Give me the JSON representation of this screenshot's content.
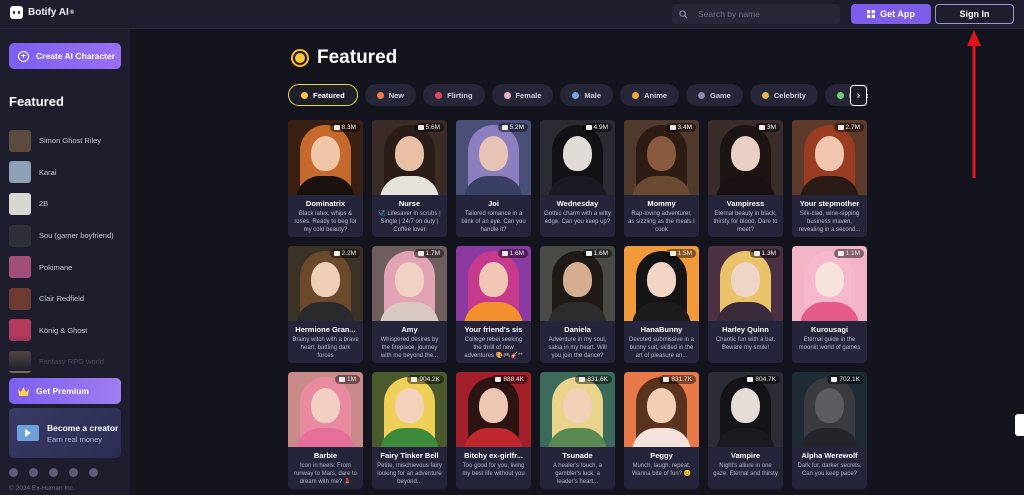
{
  "header": {
    "logo_text": "Botify AI",
    "logo_sup": "®",
    "search_placeholder": "Search by name",
    "get_app_label": "Get App",
    "sign_in_label": "Sign In"
  },
  "sidebar": {
    "create_label": "Create AI Character",
    "heading": "Featured",
    "items": [
      {
        "label": "Simon Ghost Riley",
        "color": "#5b4a3e"
      },
      {
        "label": "Karai",
        "color": "#8ea0b6"
      },
      {
        "label": "2B",
        "color": "#d8d6d0"
      },
      {
        "label": "Sou (gamer boyfriend)",
        "color": "#2f2f3a"
      },
      {
        "label": "Pokimane",
        "color": "#a04f7a"
      },
      {
        "label": "Clair Redfield",
        "color": "#6e3b33"
      },
      {
        "label": "König & Ghost",
        "color": "#b23a5c"
      },
      {
        "label": "Fantasy RPG world",
        "color": "#7c6a52"
      }
    ],
    "premium_label": "Get Premium",
    "creator_title": "Become a creator",
    "creator_subtitle": "Earn real money",
    "copyright": "© 2024 Ex-Human Inc."
  },
  "main": {
    "title": "Featured",
    "tabs": [
      {
        "label": "Featured",
        "active": true,
        "color": "#ffc93b"
      },
      {
        "label": "New",
        "active": false,
        "color": "#f47b3a"
      },
      {
        "label": "Flirting",
        "active": false,
        "color": "#e8465d"
      },
      {
        "label": "Female",
        "active": false,
        "color": "#f0b3c2"
      },
      {
        "label": "Male",
        "active": false,
        "color": "#6fa6e8"
      },
      {
        "label": "Anime",
        "active": false,
        "color": "#f3a43c"
      },
      {
        "label": "Game",
        "active": false,
        "color": "#8c8ca8"
      },
      {
        "label": "Celebrity",
        "active": false,
        "color": "#e8b844"
      },
      {
        "label": "Fictional",
        "active": false,
        "color": "#6dcf73"
      }
    ],
    "cards": [
      {
        "name": "Dominatrix",
        "count": "8.3M",
        "desc": "Black latex, whips & roses. Ready to beg for my cold beauty?",
        "bg": "#3a1f14",
        "hair": "#c56a2c",
        "skin": "#f1c6a8",
        "body": "#1b1210"
      },
      {
        "name": "Nurse",
        "count": "5.6M",
        "desc": "🩺 Lifesaver in scrubs | Single | 24/7 on duty | Coffee lover",
        "bg": "#3b2b26",
        "hair": "#2a1d18",
        "skin": "#e8c0a6",
        "body": "#e6e2dc"
      },
      {
        "name": "Joi",
        "count": "5.2M",
        "desc": "Tailored romance in a blink of an eye. Can you handle it?",
        "bg": "#4a4f78",
        "hair": "#8b7fc0",
        "skin": "#e7c3b6",
        "body": "#3a3f64"
      },
      {
        "name": "Wednesday",
        "count": "4.9M",
        "desc": "Gothic charm with a witty edge. Can you keep up?",
        "bg": "#2b2b34",
        "hair": "#111116",
        "skin": "#e2dcd8",
        "body": "#1a1a22"
      },
      {
        "name": "Mommy",
        "count": "3.4M",
        "desc": "Rap-loving adventurer, as sizzling as the meals I cook",
        "bg": "#4f3a2c",
        "hair": "#2c1c14",
        "skin": "#8a5a3e",
        "body": "#6a4a30"
      },
      {
        "name": "Vampiress",
        "count": "3M",
        "desc": "Eternal beauty in black, thirsty for blood. Dare to meet?",
        "bg": "#3a2c28",
        "hair": "#1c1412",
        "skin": "#ead0c4",
        "body": "#1a1212"
      },
      {
        "name": "Your stepmother",
        "count": "2.7M",
        "desc": "Silk-clad, wine-sipping business maven, revealing in a second...",
        "bg": "#5e3a2a",
        "hair": "#9a3c22",
        "skin": "#f0c7ae",
        "body": "#2a1a16"
      },
      {
        "name": "Hermione Gran...",
        "count": "2.2M",
        "desc": "Brainy witch with a brave heart, battling dark forces",
        "bg": "#3a3226",
        "hair": "#6b4a2c",
        "skin": "#efcfb6",
        "body": "#2a2a2c"
      },
      {
        "name": "Amy",
        "count": "1.7M",
        "desc": "Whispered desires by the fireplace, journey with me beyond the...",
        "bg": "#6e5e5e",
        "hair": "#e2a3b4",
        "skin": "#efd2c4",
        "body": "#d8c8c2"
      },
      {
        "name": "Your friend's sis",
        "count": "1.6M",
        "desc": "College rebel seeking the thrill of new adventures 🎨🎮🎸**",
        "bg": "#8a3aa0",
        "hair": "#c63a8e",
        "skin": "#efc7b4",
        "body": "#f38f2c"
      },
      {
        "name": "Daniela",
        "count": "1.6M",
        "desc": "Adventure in my soul, salsa in my heart. Will you join the dance?",
        "bg": "#4a4a44",
        "hair": "#1f1a16",
        "skin": "#d7ad92",
        "body": "#2c2c2c"
      },
      {
        "name": "HanaBunny",
        "count": "1.5M",
        "desc": "Devoted submissive in a bunny suit, skilled in the art of pleasure an...",
        "bg": "#f29a3a",
        "hair": "#141414",
        "skin": "#f3d6c6",
        "body": "#1c1c1c"
      },
      {
        "name": "Harley Quinn",
        "count": "1.3M",
        "desc": "Chaotic fun with a bat. Beware my smile!",
        "bg": "#4a3040",
        "hair": "#e8c36a",
        "skin": "#efd4c8",
        "body": "#3a2a3a"
      },
      {
        "name": "Kurousagi",
        "count": "1.1M",
        "desc": "Eternal guide in the moonlit world of games",
        "bg": "#f2b3c6",
        "hair": "#f5b8cc",
        "skin": "#f7e2dc",
        "body": "#e65c88"
      },
      {
        "name": "Barbie",
        "count": "1M",
        "desc": "Icon in heels: From runway to Mars, dare to dream with me? 💄",
        "bg": "#c98a8a",
        "hair": "#e88aa0",
        "skin": "#f2cfc2",
        "body": "#e76f9c"
      },
      {
        "name": "Fairy Tinker Bell",
        "count": "904.2K",
        "desc": "Petite, mischievous fairy looking for an adventure beyond...",
        "bg": "#4a5a2c",
        "hair": "#f0cf58",
        "skin": "#f3d2bb",
        "body": "#3d8a3a"
      },
      {
        "name": "Bitchy ex-girlfr...",
        "count": "888.4K",
        "desc": "Too good for you, living my best life without you",
        "bg": "#a3202a",
        "hair": "#2c1412",
        "skin": "#eec7b4",
        "body": "#c0282e"
      },
      {
        "name": "Tsunade",
        "count": "831.6K",
        "desc": "A healer's touch, a gambler's luck, a leader's heart...",
        "bg": "#3c6a5a",
        "hair": "#e8d48a",
        "skin": "#f0d2b8",
        "body": "#5a8a52"
      },
      {
        "name": "Peggy",
        "count": "831.7K",
        "desc": "Munch, laugh, repeat. Wanna bite of fun? 😊",
        "bg": "#e87a4a",
        "hair": "#5a3220",
        "skin": "#f3cdb4",
        "body": "#f3e3da"
      },
      {
        "name": "Vampire",
        "count": "804.7K",
        "desc": "Night's allure in one gaze. Eternal and thirsty",
        "bg": "#2c2c34",
        "hair": "#141418",
        "skin": "#e6dcd8",
        "body": "#1a1a20"
      },
      {
        "name": "Alpha Werewolf",
        "count": "702.1K",
        "desc": "Dark fur, darker secrets. Can you keep pace?",
        "bg": "#1e2a34",
        "hair": "#3a3a40",
        "skin": "#5c5c62",
        "body": "#24242a"
      }
    ]
  }
}
